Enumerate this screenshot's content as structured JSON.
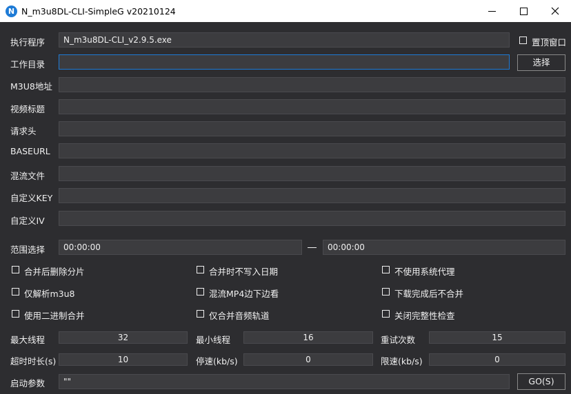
{
  "window": {
    "title": "N_m3u8DL-CLI-SimpleG v20210124",
    "icon_letter": "N"
  },
  "form": {
    "exe_label": "执行程序",
    "exe_value": "N_m3u8DL-CLI_v2.9.5.exe",
    "topmost_label": "置顶窗口",
    "workdir_label": "工作目录",
    "workdir_value": "",
    "choose_label": "选择",
    "m3u8_label": "M3U8地址",
    "m3u8_value": "",
    "title_label": "视频标题",
    "title_value": "",
    "headers_label": "请求头",
    "headers_value": "",
    "baseurl_label": "BASEURL",
    "baseurl_value": "",
    "mux_label": "混流文件",
    "mux_value": "",
    "key_label": "自定义KEY",
    "key_value": "",
    "iv_label": "自定义IV",
    "iv_value": "",
    "range_label": "范围选择",
    "range_start": "00:00:00",
    "range_sep": "—",
    "range_end": "00:00:00"
  },
  "options": [
    {
      "label": "合并后删除分片",
      "checked": false
    },
    {
      "label": "合并时不写入日期",
      "checked": false
    },
    {
      "label": "不使用系统代理",
      "checked": false
    },
    {
      "label": "仅解析m3u8",
      "checked": false
    },
    {
      "label": "混流MP4边下边看",
      "checked": false
    },
    {
      "label": "下载完成后不合并",
      "checked": false
    },
    {
      "label": "使用二进制合并",
      "checked": false
    },
    {
      "label": "仅合并音频轨道",
      "checked": false
    },
    {
      "label": "关闭完整性检查",
      "checked": false
    }
  ],
  "numbers": {
    "max_threads_label": "最大线程",
    "max_threads": "32",
    "min_threads_label": "最小线程",
    "min_threads": "16",
    "retry_label": "重试次数",
    "retry": "15",
    "timeout_label": "超时时长(s)",
    "timeout": "10",
    "stop_speed_label": "停速(kb/s)",
    "stop_speed": "0",
    "limit_speed_label": "限速(kb/s)",
    "limit_speed": "0"
  },
  "launch": {
    "args_label": "启动参数",
    "args_value": "\"\"",
    "go_label": "GO(S)"
  },
  "colors": {
    "background": "#2d2d30",
    "field": "#3c3c3f",
    "accent": "#1e7bd6"
  }
}
